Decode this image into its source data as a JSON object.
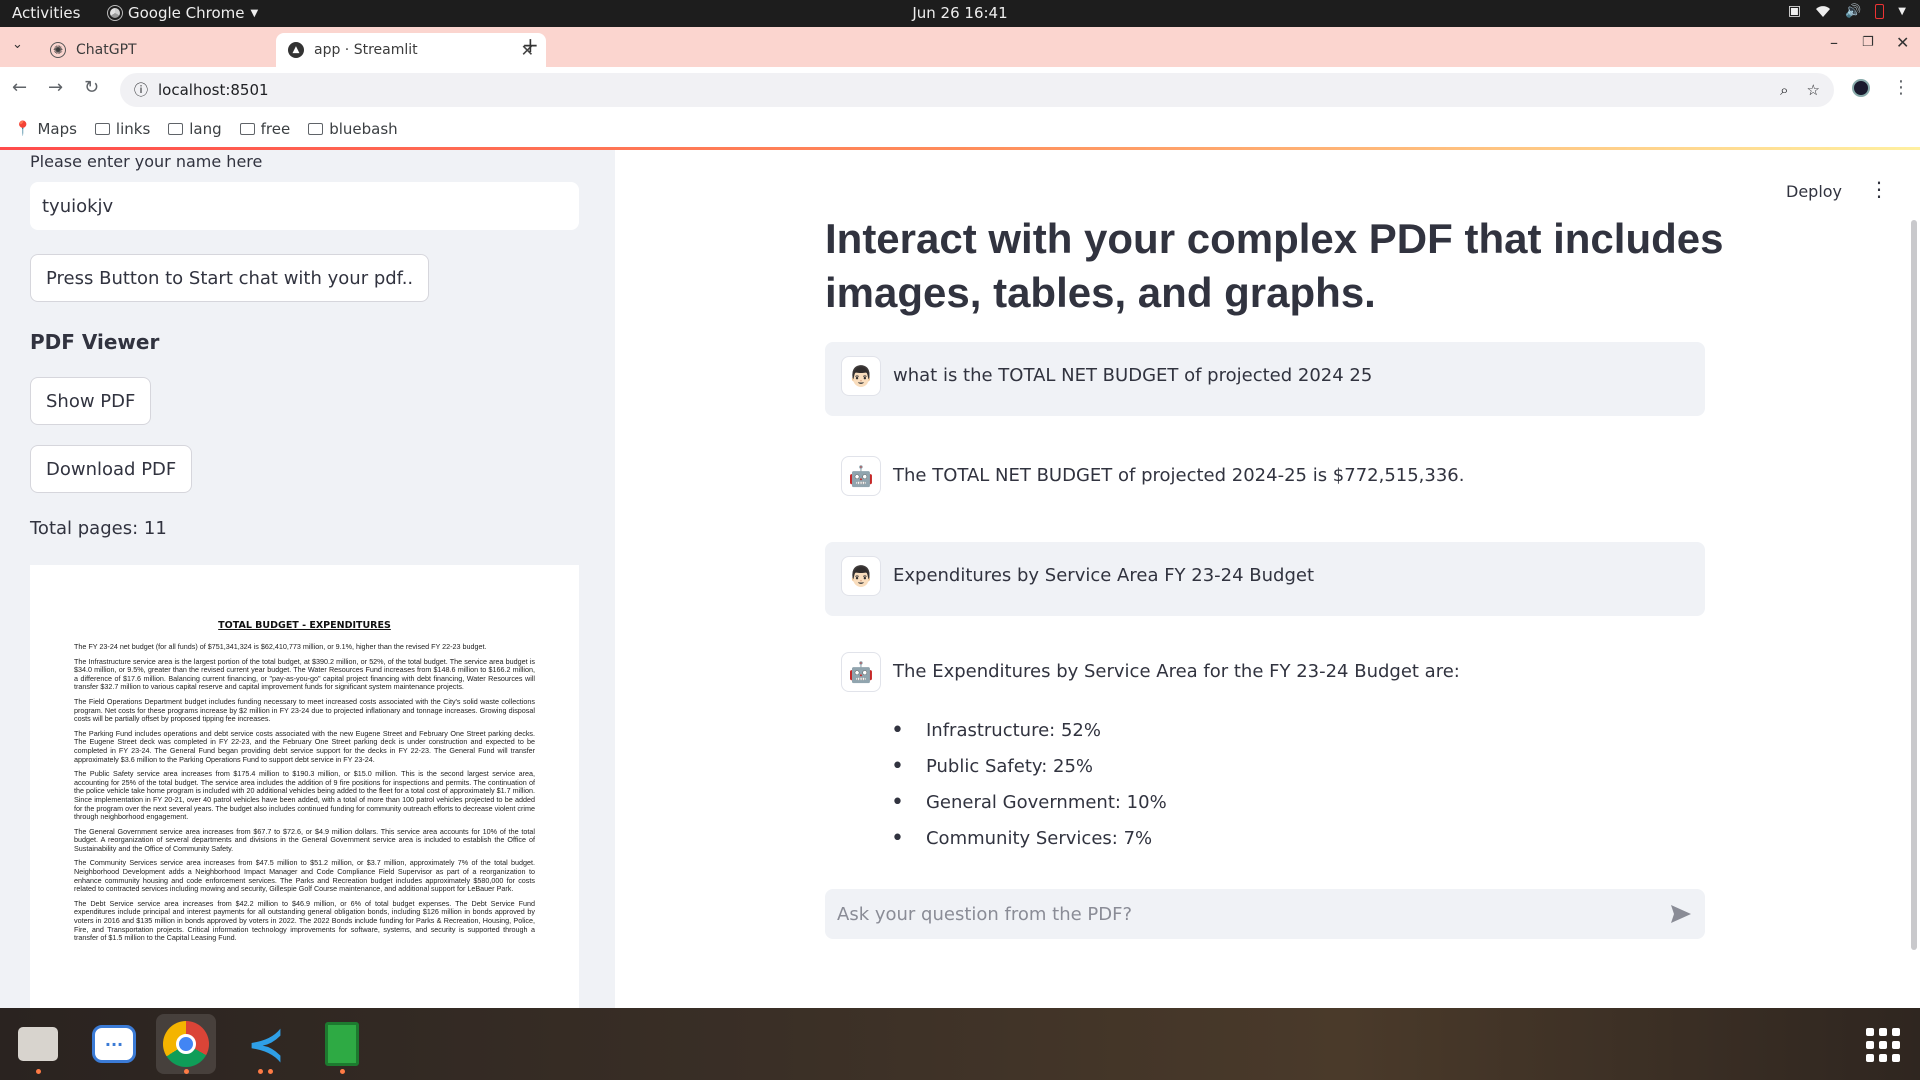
{
  "os": {
    "activities": "Activities",
    "app_name": "Google Chrome",
    "clock": "Jun 26  16:41"
  },
  "browser": {
    "tabs": [
      {
        "title": "ChatGPT"
      },
      {
        "title": "app · Streamlit"
      }
    ],
    "url": "localhost:8501",
    "bookmarks": [
      "Maps",
      "links",
      "lang",
      "free",
      "bluebash"
    ]
  },
  "sidebar": {
    "name_label": "Please enter your name here",
    "name_value": "tyuiokjv",
    "start_chat_button": "Press Button to Start chat with your pdf..",
    "pdf_viewer_title": "PDF Viewer",
    "show_pdf_button": "Show PDF",
    "download_pdf_button": "Download PDF",
    "total_pages": "Total pages: 11",
    "pdf_preview": {
      "heading": "TOTAL BUDGET - EXPENDITURES",
      "paragraphs": [
        "The FY 23-24 net budget (for all funds) of $751,341,324 is $62,410,773 million, or 9.1%, higher than the revised FY 22-23 budget.",
        "The Infrastructure service area is the largest portion of the total budget, at $390.2 million, or 52%, of the total budget. The service area budget is $34.0 million, or 9.5%, greater than the revised current year budget. The Water Resources Fund increases from $148.6 million to $166.2 million, a difference of $17.6 million. Balancing current financing, or \"pay-as-you-go\" capital project financing with debt financing, Water Resources will transfer $32.7 million to various capital reserve and capital improvement funds for significant system maintenance projects.",
        "The Field Operations Department budget includes funding necessary to meet increased costs associated with the City's solid waste collections program. Net costs for these programs increase by $2 million in FY 23-24 due to projected inflationary and tonnage increases. Growing disposal costs will be partially offset by proposed tipping fee increases.",
        "The Parking Fund includes operations and debt service costs associated with the new Eugene Street and February One Street parking decks. The Eugene Street deck was completed in FY 22-23, and the February One Street parking deck is under construction and expected to be completed in FY 23-24. The General Fund began providing debt service support for the decks in FY 22-23. The General Fund will transfer approximately $3.6 million to the Parking Operations Fund to support debt service in FY 23-24.",
        "The Public Safety service area increases from $175.4 million to $190.3 million, or $15.0 million. This is the second largest service area, accounting for 25% of the total budget. The service area includes the addition of 9 fire positions for inspections and permits. The continuation of the police vehicle take home program is included with 20 additional vehicles being added to the fleet for a total cost of approximately $1.7 million. Since implementation in FY 20-21, over 40 patrol vehicles have been added, with a total of more than 100 patrol vehicles projected to be added for the program over the next several years. The budget also includes continued funding for community outreach efforts to decrease violent crime through neighborhood engagement.",
        "The General Government service area increases from $67.7 to $72.6, or $4.9 million dollars. This service area accounts for 10% of the total budget. A reorganization of several departments and divisions in the General Government service area is included to establish the Office of Sustainability and the Office of Community Safety.",
        "The Community Services service area increases from $47.5 million to $51.2 million, or $3.7 million, approximately 7% of the total budget. Neighborhood Development adds a Neighborhood Impact Manager and Code Compliance Field Supervisor as part of a reorganization to enhance community housing and code enforcement services. The Parks and Recreation budget includes approximately $580,000 for costs related to contracted services including mowing and security, Gillespie Golf Course maintenance, and additional support for LeBauer Park.",
        "The Debt Service service area increases from $42.2 million to $46.9 million, or 6% of total budget expenses. The Debt Service Fund expenditures include principal and interest payments for all outstanding general obligation bonds, including $126 million in bonds approved by voters in 2016 and $135 million in bonds approved by voters in 2022. The 2022 Bonds include funding for Parks & Recreation, Housing, Police, Fire, and Transportation projects. Critical information technology improvements for software, systems, and security is supported through a transfer of $1.5 million to the Capital Leasing Fund."
      ]
    }
  },
  "main": {
    "deploy_label": "Deploy",
    "title": "Interact with your complex PDF that includes images, tables, and graphs.",
    "messages": [
      {
        "role": "user",
        "avatar": "👨🏻",
        "text": "what is the TOTAL NET BUDGET of projected 2024 25"
      },
      {
        "role": "assistant",
        "avatar": "🤖",
        "text": "The TOTAL NET BUDGET of projected 2024-25 is $772,515,336."
      },
      {
        "role": "user",
        "avatar": "👨🏻",
        "text": "Expenditures by Service Area FY 23-24 Budget"
      },
      {
        "role": "assistant",
        "avatar": "🤖",
        "text": "The Expenditures by Service Area for the FY 23-24 Budget are:"
      }
    ],
    "bullets": [
      "Infrastructure: 52%",
      "Public Safety: 25%",
      "General Government: 10%",
      "Community Services: 7%"
    ],
    "chat_placeholder": "Ask your question from the PDF?"
  }
}
